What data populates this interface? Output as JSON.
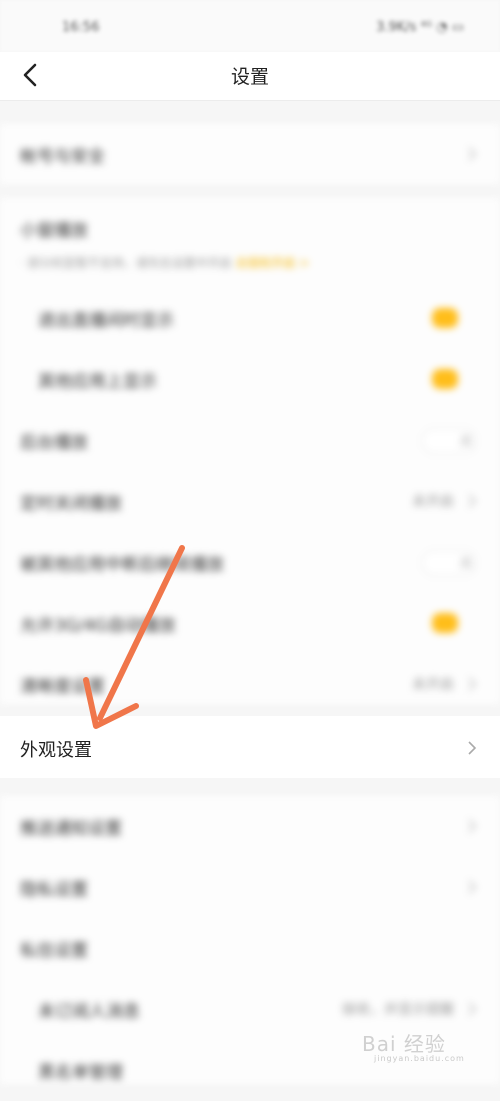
{
  "status_bar": {
    "time": "16:56",
    "right": "3.9K/s ⁴ᴳ ◔ ▭"
  },
  "nav": {
    "title": "设置"
  },
  "rows": [
    {
      "label": "帐号与安全"
    },
    {
      "label": "小窗播放"
    },
    {
      "label": "退出直播间时显示"
    },
    {
      "label": "其他应用上显示"
    },
    {
      "label": "后台播放",
      "toggle": "关"
    },
    {
      "label": "定时关闭播放",
      "value": "未开启"
    },
    {
      "label": "被其他应用中断后继续播放",
      "toggle": "关"
    },
    {
      "label": "允许3G/4G自动播放"
    },
    {
      "label": "清晰度设置",
      "value": "未开启"
    },
    {
      "label": "外观设置"
    },
    {
      "label": "推送通知设置"
    },
    {
      "label": "隐私设置"
    },
    {
      "label": "私信设置"
    },
    {
      "label": "未订阅人消息",
      "value": "接收，并显示提醒"
    },
    {
      "label": "黑名单管理"
    }
  ],
  "note": {
    "text": "· 部分机型暂不支持，请先在设置中开启",
    "link": "去授权开启 >"
  },
  "watermark": {
    "text": "Bai 经验",
    "sub": "jingyan.baidu.com"
  },
  "colors": {
    "accent": "#ffbe1a",
    "arrow": "#f0764a"
  }
}
